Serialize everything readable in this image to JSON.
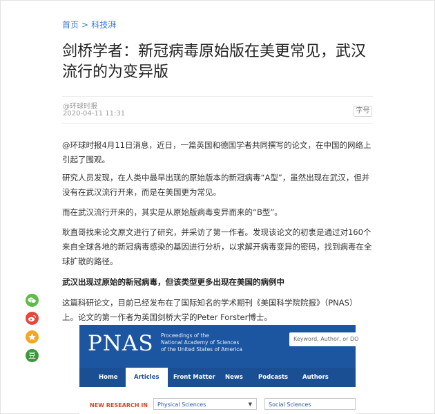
{
  "breadcrumb": {
    "home": "首页",
    "separator": ">",
    "section": "科技湃"
  },
  "article": {
    "title": "剑桥学者：新冠病毒原始版在美更常见，武汉流行的为变异版",
    "source": "@环球时报",
    "date": "2020-04-11 11:31",
    "font_size_button": "字号",
    "paragraphs": [
      "@环球时报4月11日消息，近日，一篇英国和德国学者共同撰写的论文，在中国的网络上引起了围观。",
      "研究人员发现，在人类中最早出现的原始版本的新冠病毒“A型”，虽然出现在武汉，但并没有在武汉流行开来，而是在美国更为常见。",
      "而在武汉流行开来的，其实是从原始版病毒变异而来的“B型”。",
      "耿直哥找来论文原文进行了研究，并采访了第一作者。发现该论文的初衷是通过对160个来自全球各地的新冠病毒感染的基因进行分析，以求解开病毒变异的密码，找到病毒在全球扩散的路径。",
      "武汉出现过原始的新冠病毒，但该类型更多出现在美国的病例中",
      "这篇科研论文，目前已经发布在了国际知名的学术期刊《美国科学院院报》（PNAS）上。论文的第一作者为英国剑桥大学的Peter Forster博士。"
    ]
  },
  "share": {
    "icons": [
      "wechat-icon",
      "weibo-icon",
      "qzone-icon",
      "douban-icon"
    ],
    "douban_label": "豆",
    "colors": {
      "wechat": "#5dbb46",
      "weibo": "#e8453c",
      "qzone": "#f5a623",
      "douban": "#3a9a3a"
    }
  },
  "pnas_image": {
    "logo": "PNAS",
    "subtitle": [
      "Proceedings of the",
      "National Academy of Sciences",
      "of the United States of America"
    ],
    "search_placeholder": "Keyword, Author, or DOI",
    "nav": [
      "Home",
      "Articles",
      "Front Matter",
      "News",
      "Podcasts",
      "Authors"
    ],
    "active_nav": "Articles",
    "research_label": "NEW RESEARCH IN",
    "selects": [
      "Physical Sciences",
      "Social Sciences"
    ]
  },
  "colors": {
    "link": "#3a7bd5",
    "pnas_blue": "#1d56a0",
    "pnas_red": "#d5472f"
  }
}
